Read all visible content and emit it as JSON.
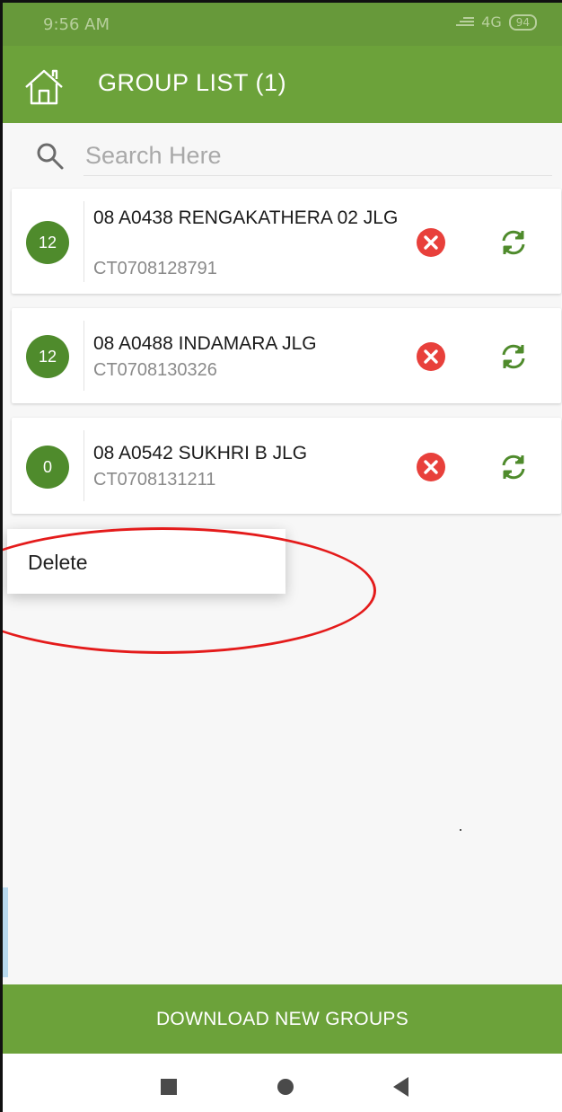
{
  "status_bar": {
    "time": "9:56 AM",
    "network": "4G",
    "battery": "94"
  },
  "app_bar": {
    "title": "GROUP LIST (1)",
    "home_icon": "home-icon"
  },
  "search": {
    "placeholder": "Search Here",
    "value": "",
    "icon": "search-icon"
  },
  "groups": [
    {
      "count": "12",
      "name": "08 A0438 RENGAKATHERA 02 JLG",
      "code": "CT0708128791"
    },
    {
      "count": "12",
      "name": "08 A0488 INDAMARA JLG",
      "code": "CT0708130326"
    },
    {
      "count": "0",
      "name": "08 A0542 SUKHRI B JLG",
      "code": "CT0708131211"
    }
  ],
  "context_menu": {
    "items": [
      {
        "label": "Delete"
      }
    ]
  },
  "footer": {
    "download_label": "DOWNLOAD NEW GROUPS"
  },
  "colors": {
    "primary": "#6ca23a",
    "badge": "#4f8b2c",
    "delete": "#e8403b",
    "annotation": "#e41b1b"
  }
}
